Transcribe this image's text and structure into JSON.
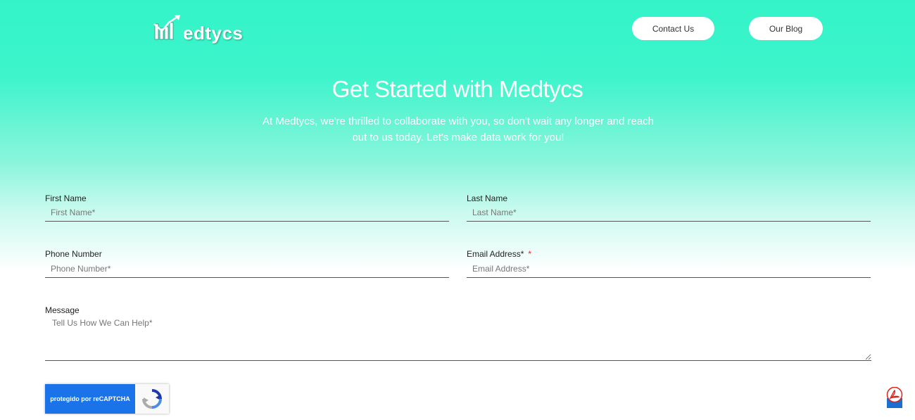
{
  "header": {
    "logo_text": "edtycs",
    "nav": {
      "contact_label": "Contact Us",
      "blog_label": "Our Blog"
    }
  },
  "hero": {
    "title": "Get Started with Medtycs",
    "subtitle": "At Medtycs, we're thrilled to collaborate with you, so don't wait any longer and reach out to us today. Let's make data work for you!"
  },
  "form": {
    "first_name": {
      "label": "First Name",
      "placeholder": "First Name*",
      "value": ""
    },
    "last_name": {
      "label": "Last Name",
      "placeholder": "Last Name*",
      "value": ""
    },
    "phone": {
      "label": "Phone Number",
      "placeholder": "Phone Number*",
      "value": ""
    },
    "email": {
      "label": "Email Address*",
      "required_mark": "*",
      "placeholder": "Email Address*",
      "value": ""
    },
    "message": {
      "label": "Message",
      "placeholder": "Tell Us How We Can Help*",
      "value": ""
    }
  },
  "recaptcha": {
    "label": "protegido por reCAPTCHA",
    "icon": "recaptcha-icon"
  },
  "widgets": {
    "pdf_icon": "pdf-icon"
  },
  "colors": {
    "accent_gradient_top": "#33f4c8",
    "recaptcha_blue": "#1a73e8",
    "required_red": "#e02424",
    "pdf_red": "#d9241c"
  }
}
